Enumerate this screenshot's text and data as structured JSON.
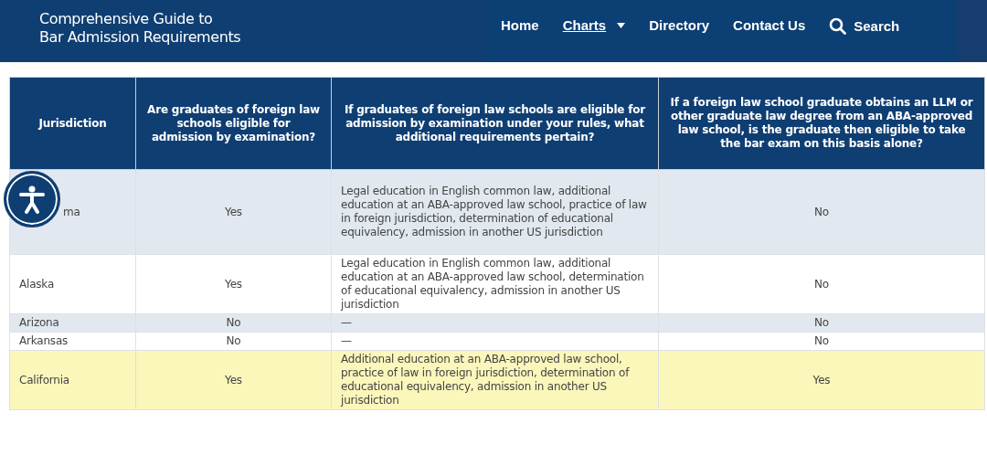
{
  "site_title": [
    "Comprehensive Guide to",
    "Bar Admission Requirements"
  ],
  "nav": [
    {
      "label": "Home",
      "selected": false,
      "kind": "link"
    },
    {
      "label": "Charts",
      "selected": true,
      "kind": "dropdown"
    },
    {
      "label": "Directory",
      "selected": false,
      "kind": "link"
    },
    {
      "label": "Contact Us",
      "selected": false,
      "kind": "link"
    },
    {
      "label": "Search",
      "selected": false,
      "kind": "search"
    }
  ],
  "table": {
    "columns": [
      "Jurisdiction",
      "Are graduates of foreign law schools eligible for admission by examination?",
      "If graduates of foreign law schools are eligible for admission by examination under your rules, what additional requirements pertain?",
      "If a foreign law school graduate obtains an LLM or other graduate law degree from an ABA-approved law school, is the graduate then eligible to take the bar exam on this basis alone?"
    ],
    "rows": [
      {
        "cells": [
          "ma",
          "Yes",
          "Legal education in English common law, additional education at an ABA-approved law school, practice of law in foreign jurisdiction, determination of educational equivalency, admission in another US jurisdiction",
          "No"
        ],
        "highlighted": false
      },
      {
        "cells": [
          "Alaska",
          "Yes",
          "Legal education in English common law, additional education at an ABA-approved law school, determination of educational equivalency, admission in another US jurisdiction",
          "No"
        ],
        "highlighted": false
      },
      {
        "cells": [
          "Arizona",
          "No",
          "—",
          "No"
        ],
        "highlighted": false
      },
      {
        "cells": [
          "Arkansas",
          "No",
          "—",
          "No"
        ],
        "highlighted": false
      },
      {
        "cells": [
          "California",
          "Yes",
          "Additional education at an ABA-approved law school, practice of law in foreign jurisdiction, determination of educational equivalency, admission in another US jurisdiction",
          "Yes"
        ],
        "highlighted": true
      }
    ]
  }
}
